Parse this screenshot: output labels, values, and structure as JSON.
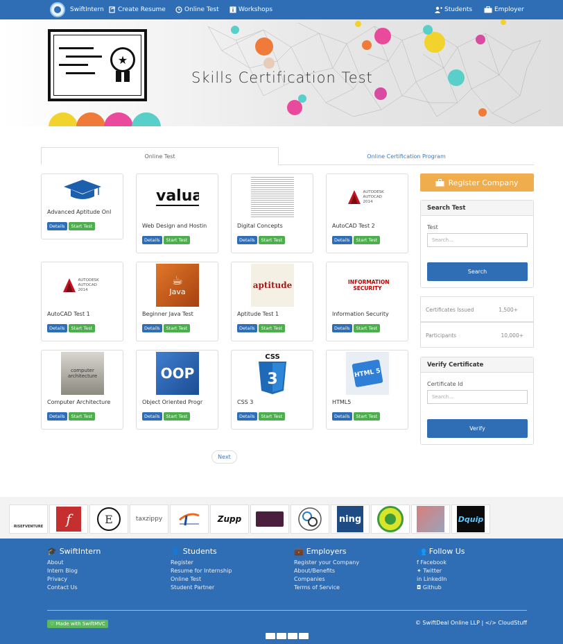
{
  "nav": {
    "brand": "SwiftIntern",
    "create_resume": "Create Resume",
    "online_test": "Online Test",
    "workshops": "Workshops",
    "students": "Students",
    "employer": "Employer"
  },
  "hero": {
    "title": "Skills Certification Test"
  },
  "tabs": {
    "active": "Online Test",
    "other": "Online Certification Program"
  },
  "cards": [
    {
      "name": "Advanced Aptitude Onl",
      "icon": "graduation-cap"
    },
    {
      "name": "Web Design and Hostin",
      "thumb_text": "valua"
    },
    {
      "name": "Digital Concepts",
      "icon": "binary-digits"
    },
    {
      "name": "AutoCAD Test 2",
      "thumb_text": "AUTODESK AUTOCAD 2014"
    },
    {
      "name": "AutoCAD Test 1",
      "thumb_text": "AUTODESK AUTOCAD 2014"
    },
    {
      "name": "Beginner Java Test",
      "thumb_text": "Java"
    },
    {
      "name": "Aptitude Test 1",
      "thumb_text": "aptitude"
    },
    {
      "name": "Information Security",
      "thumb_text": "INFORMATION SECURITY"
    },
    {
      "name": "Computer Architecture",
      "thumb_text": "computer architecture"
    },
    {
      "name": "Object Oriented Progr",
      "thumb_text": "OOP"
    },
    {
      "name": "CSS 3",
      "thumb_text": "CSS"
    },
    {
      "name": "HTML5",
      "thumb_text": "HTML 5"
    }
  ],
  "card_buttons": {
    "details": "Details",
    "start": "Start Test"
  },
  "sidebar": {
    "register": "Register Company",
    "search_panel": {
      "title": "Search Test",
      "label": "Test",
      "placeholder": "Search...",
      "button": "Search"
    },
    "stats": [
      {
        "label": "Certificates Issued",
        "value": "1,500+"
      },
      {
        "label": "Participants",
        "value": "10,000+"
      }
    ],
    "verify_panel": {
      "title": "Verify Certificate",
      "label": "Certificate Id",
      "placeholder": "Search...",
      "button": "Verify"
    }
  },
  "pagination": {
    "next": "Next"
  },
  "partners": [
    "RISEFVENTURE",
    "f",
    "E",
    "taxzippy",
    "",
    "Zupp",
    "",
    "",
    "ning",
    "",
    "",
    "Dquip"
  ],
  "footer": {
    "cols": [
      {
        "title": "SwiftIntern",
        "links": [
          "About",
          "Intern Blog",
          "Privacy",
          "Contact Us"
        ]
      },
      {
        "title": "Students",
        "links": [
          "Register",
          "Resume for Internship",
          "Online Test",
          "Student Partner"
        ]
      },
      {
        "title": "Employers",
        "links": [
          "Register your Company",
          "About/Benefits",
          "Companies",
          "Terms of Service"
        ]
      },
      {
        "title": "Follow Us",
        "links": [
          "Facebook",
          "Twitter",
          "LinkedIn",
          "Github"
        ]
      }
    ],
    "made": "Made with SwiftMVC",
    "copyright": "SwiftDeal Online LLP | </> CloudStuff"
  },
  "colors": {
    "nav": "#2f6db5",
    "accent_orange": "#f0ad4e",
    "green": "#4cae4c"
  }
}
